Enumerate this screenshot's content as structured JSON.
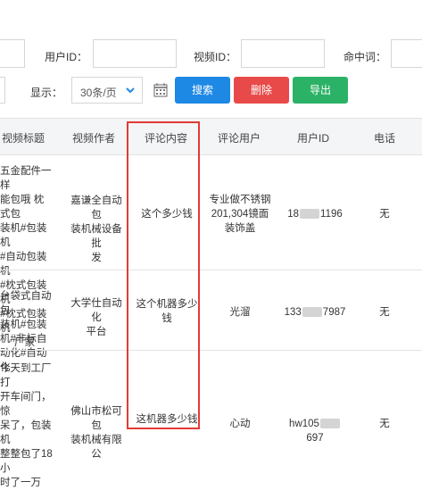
{
  "filters": {
    "user_id_label": "用户ID：",
    "video_id_label": "视频ID：",
    "hit_word_label": "命中词：",
    "display_label": "显示：",
    "page_size": "30条/页",
    "search_label": "搜索",
    "delete_label": "删除",
    "export_label": "导出"
  },
  "table": {
    "headers": [
      "视频标题",
      "视频作者",
      "评论内容",
      "评论用户",
      "用户ID",
      "电话"
    ],
    "rows": [
      {
        "title_lines": [
          "五金配件一样",
          "能包哦 枕式包",
          "装机#包装机",
          "#自动包装机",
          "#枕式包装机",
          "#枕式包装机",
          "厂家"
        ],
        "author_lines": [
          "嘉谦全自动包",
          "装机械设备批",
          "发"
        ],
        "comment_lines": [
          "这个多少钱"
        ],
        "user_lines": [
          "专业做不锈钢",
          "201,304镜面",
          "装饰盖"
        ],
        "uid_prefix": "18",
        "uid_suffix": "1196",
        "phone": "无"
      },
      {
        "title_lines": [
          "台袋式自动包",
          "装机#包装机#非标自",
          "动化#自动化"
        ],
        "author_lines": [
          "大学仕自动化",
          "平台"
        ],
        "comment_lines": [
          "这个机器多少",
          "钱"
        ],
        "user_lines": [
          "光溜"
        ],
        "uid_prefix": "133",
        "uid_suffix": "7987",
        "phone": "无"
      },
      {
        "title_lines": [
          "今天到工厂打",
          "开车间门，惊",
          "呆了，包装机",
          "整整包了18小",
          "时了一万"
        ],
        "author_lines": [
          "佛山市松可包",
          "装机械有限公"
        ],
        "comment_lines": [
          "这机器多少钱"
        ],
        "user_lines": [
          "心动"
        ],
        "uid_prefix": "hw105",
        "uid_suffix": "697",
        "phone": "无"
      }
    ]
  }
}
